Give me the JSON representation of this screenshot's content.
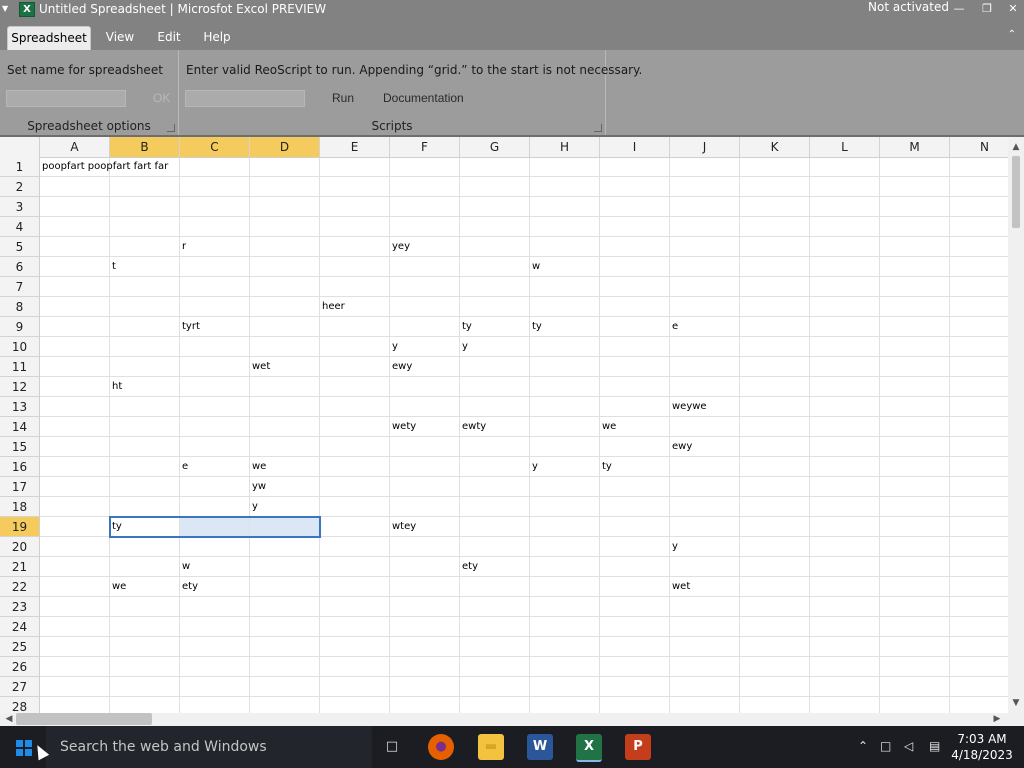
{
  "window": {
    "title": "Untitled Spreadsheet | Microsfot Excol PREVIEW",
    "status": "Not activated",
    "system_menu_icon": "triangle-down-icon",
    "app_icon": "excol-app-icon",
    "minimize": "—",
    "maximize": "❐",
    "close": "✕"
  },
  "menu": {
    "tabs": [
      {
        "label": "Spreadsheet",
        "active": true
      },
      {
        "label": "View",
        "active": false
      },
      {
        "label": "Edit",
        "active": false
      },
      {
        "label": "Help",
        "active": false
      }
    ],
    "collapse_icon": "⌃"
  },
  "ribbon": {
    "spreadsheet_options": {
      "prompt": "Set name for spreadsheet",
      "name_value": "",
      "ok_label": "OK",
      "caption": "Spreadsheet options"
    },
    "scripts": {
      "prompt": "Enter valid ReoScript to run. Appending “grid.” to the start is not necessary.",
      "script_value": "",
      "run_label": "Run",
      "documentation_label": "Documentation",
      "caption": "Scripts"
    }
  },
  "grid": {
    "columns": [
      "A",
      "B",
      "C",
      "D",
      "E",
      "F",
      "G",
      "H",
      "I",
      "J",
      "K",
      "L",
      "M",
      "N"
    ],
    "rows": [
      "1",
      "2",
      "3",
      "4",
      "5",
      "6",
      "7",
      "8",
      "9",
      "10",
      "11",
      "12",
      "13",
      "14",
      "15",
      "16",
      "17",
      "18",
      "19",
      "20",
      "21",
      "22",
      "23",
      "24",
      "25",
      "26",
      "27",
      "28"
    ],
    "selected_columns": [
      "B",
      "C",
      "D"
    ],
    "selected_row": "19",
    "selection": "B19:D19",
    "active_cell": "B19",
    "cells": [
      {
        "ref": "A1",
        "value": "poopfart poopfart fart far"
      },
      {
        "ref": "C5",
        "value": "r"
      },
      {
        "ref": "F5",
        "value": "yey"
      },
      {
        "ref": "B6",
        "value": "t"
      },
      {
        "ref": "H6",
        "value": "w"
      },
      {
        "ref": "E8",
        "value": "heer"
      },
      {
        "ref": "C9",
        "value": "tyrt"
      },
      {
        "ref": "G9",
        "value": "ty"
      },
      {
        "ref": "H9",
        "value": "ty"
      },
      {
        "ref": "J9",
        "value": "e"
      },
      {
        "ref": "F10",
        "value": "y"
      },
      {
        "ref": "G10",
        "value": "y"
      },
      {
        "ref": "D11",
        "value": "wet"
      },
      {
        "ref": "F11",
        "value": "ewy"
      },
      {
        "ref": "B12",
        "value": "ht"
      },
      {
        "ref": "J13",
        "value": "weywe"
      },
      {
        "ref": "F14",
        "value": "wety"
      },
      {
        "ref": "G14",
        "value": "ewty"
      },
      {
        "ref": "I14",
        "value": "we"
      },
      {
        "ref": "J15",
        "value": "ewy"
      },
      {
        "ref": "C16",
        "value": "e"
      },
      {
        "ref": "D16",
        "value": "we"
      },
      {
        "ref": "H16",
        "value": "y"
      },
      {
        "ref": "I16",
        "value": "ty"
      },
      {
        "ref": "D17",
        "value": "yw"
      },
      {
        "ref": "D18",
        "value": "y"
      },
      {
        "ref": "B19",
        "value": "ty"
      },
      {
        "ref": "F19",
        "value": "wtey"
      },
      {
        "ref": "J20",
        "value": "y"
      },
      {
        "ref": "C21",
        "value": "w"
      },
      {
        "ref": "G21",
        "value": "ety"
      },
      {
        "ref": "B22",
        "value": "we"
      },
      {
        "ref": "C22",
        "value": "ety"
      },
      {
        "ref": "J22",
        "value": "wet"
      }
    ]
  },
  "scrollbars": {
    "up": "▲",
    "down": "▼",
    "left": "◀",
    "right": "▶"
  },
  "taskbar": {
    "start_icon": "windows-start-icon",
    "search_placeholder": "Search the web and Windows",
    "apps": [
      {
        "name": "task-view-icon",
        "glyph": "□"
      },
      {
        "name": "firefox-icon",
        "glyph": "●"
      },
      {
        "name": "file-explorer-icon",
        "glyph": "▬"
      },
      {
        "name": "word-icon",
        "glyph": "W"
      },
      {
        "name": "excol-icon",
        "glyph": "X"
      },
      {
        "name": "powerpoint-icon",
        "glyph": "P"
      }
    ],
    "tray": {
      "chevron": "⌃",
      "network": "□",
      "volume": "◁",
      "notifications": "▤"
    },
    "time": "7:03 AM",
    "date": "4/18/2023"
  },
  "colors": {
    "titlebar": "#828282",
    "ribbon": "#9c9c9c",
    "selected_header": "#f4cb5c",
    "selection_border": "#3a75c4",
    "taskbar": "#1b1d22"
  }
}
